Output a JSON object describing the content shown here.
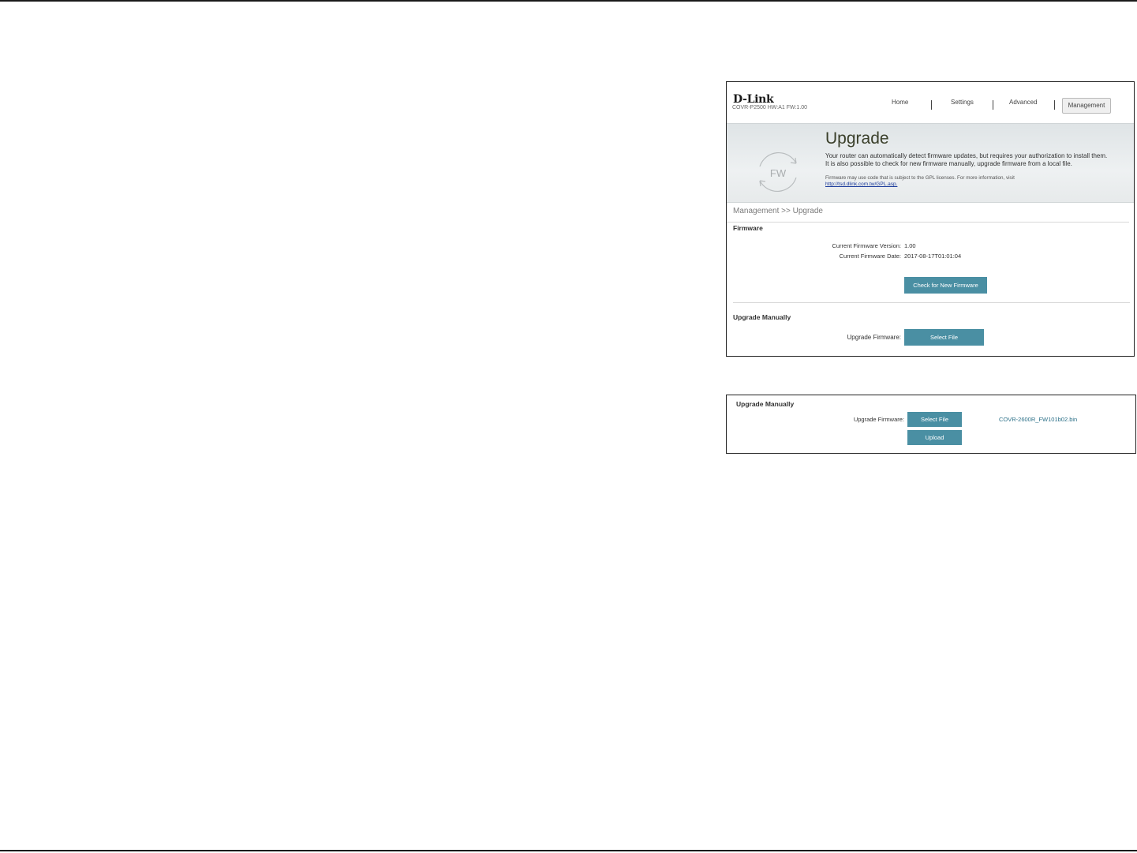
{
  "header": {
    "brand": "D-Link",
    "model_info": "COVR-P2500   HW:A1   FW:1.00",
    "nav": [
      "Home",
      "Settings",
      "Advanced",
      "Management"
    ],
    "active_nav": "Management"
  },
  "banner": {
    "icon_text": "FW",
    "title": "Upgrade",
    "desc_line1": "Your router can automatically detect firmware updates, but requires your authorization to install them.",
    "desc_line2": "It is also possible to check for new firmware manually, upgrade firmware from a local file.",
    "note": "Firmware may use code that is subject to the GPL licenses. For more information, visit",
    "link": "http://tsd.dlink.com.tw/GPL.asp."
  },
  "breadcrumb": "Management >> Upgrade",
  "firmware": {
    "section_title": "Firmware",
    "version_label": "Current Firmware Version:",
    "version_value": "1.00",
    "date_label": "Current Firmware Date:",
    "date_value": "2017-08-17T01:01:04",
    "check_button": "Check for New Firmware"
  },
  "manual": {
    "section_title": "Upgrade Manually",
    "upgrade_label": "Upgrade Firmware:",
    "select_button": "Select File"
  },
  "manual_upload": {
    "section_title": "Upgrade Manually",
    "upgrade_label": "Upgrade Firmware:",
    "select_button": "Select File",
    "upload_button": "Upload",
    "filename": "COVR-2600R_FW101b02.bin"
  }
}
